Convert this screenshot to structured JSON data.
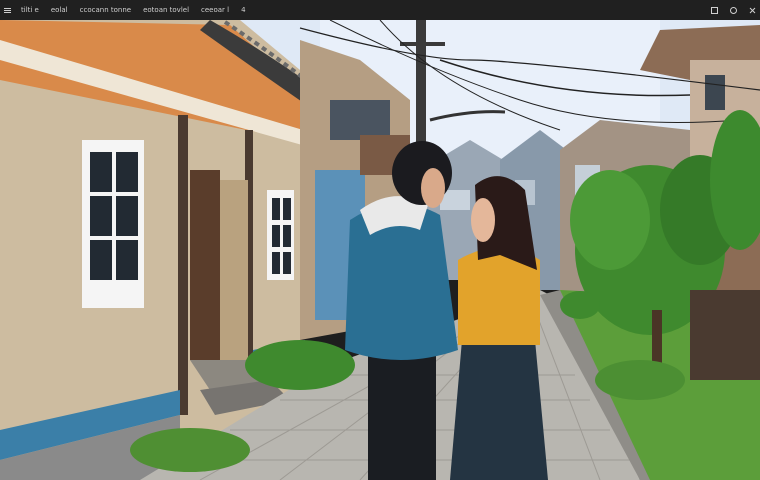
{
  "topbar": {
    "items": [
      {
        "label": "tilti e"
      },
      {
        "label": "eolal"
      },
      {
        "label": "ccocann tonne"
      },
      {
        "label": "eotoan tovlel"
      },
      {
        "label": "ceeoar l"
      }
    ],
    "extra": "4"
  },
  "scene": {
    "sky_color": "#dfe9f6",
    "house_left_wall": "#cdbca0",
    "house_left_trim": "#d98a4a",
    "girl_sweater": "#e2a32b",
    "boy_jacket": "#2a6f93",
    "foliage": "#3f8a2e",
    "pavement": "#b8b6b0"
  }
}
